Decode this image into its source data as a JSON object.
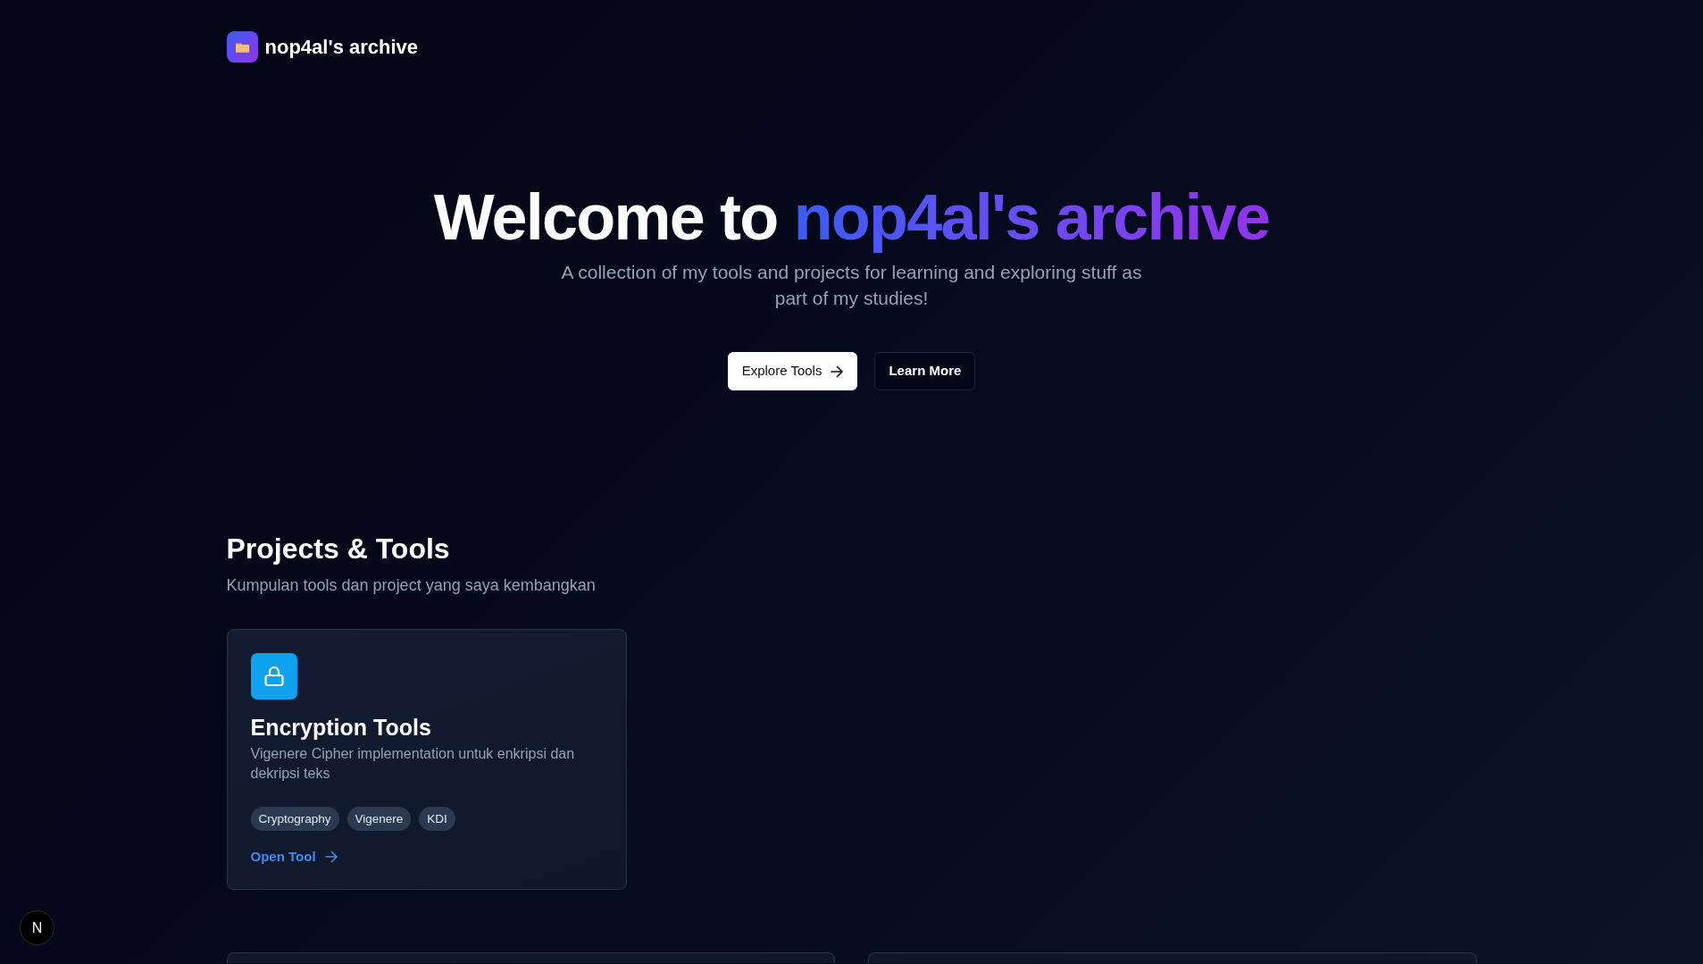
{
  "nav": {
    "brand": "nop4al's archive"
  },
  "hero": {
    "title": "Welcome to",
    "title_highlight": "nop4al's archive",
    "subtitle": "A collection of my tools and projects for learning and exploring stuff as part of my studies!",
    "buttons": [
      {
        "label": "Explore Tools",
        "kind": "primary"
      },
      {
        "label": "Learn More",
        "kind": "outline"
      }
    ]
  },
  "projects": {
    "heading": "Projects & Tools",
    "subheading": "Kumpulan tools dan project yang saya kembangkan",
    "cards": [
      {
        "title": "Encryption Tools",
        "description": "Vigenere Cipher implementation untuk enkripsi dan dekripsi teks",
        "tags": [
          "Cryptography",
          "Vigenere",
          "KDI"
        ],
        "link": "Open Tool"
      }
    ]
  },
  "dev_indicator": {
    "label": "N"
  }
}
